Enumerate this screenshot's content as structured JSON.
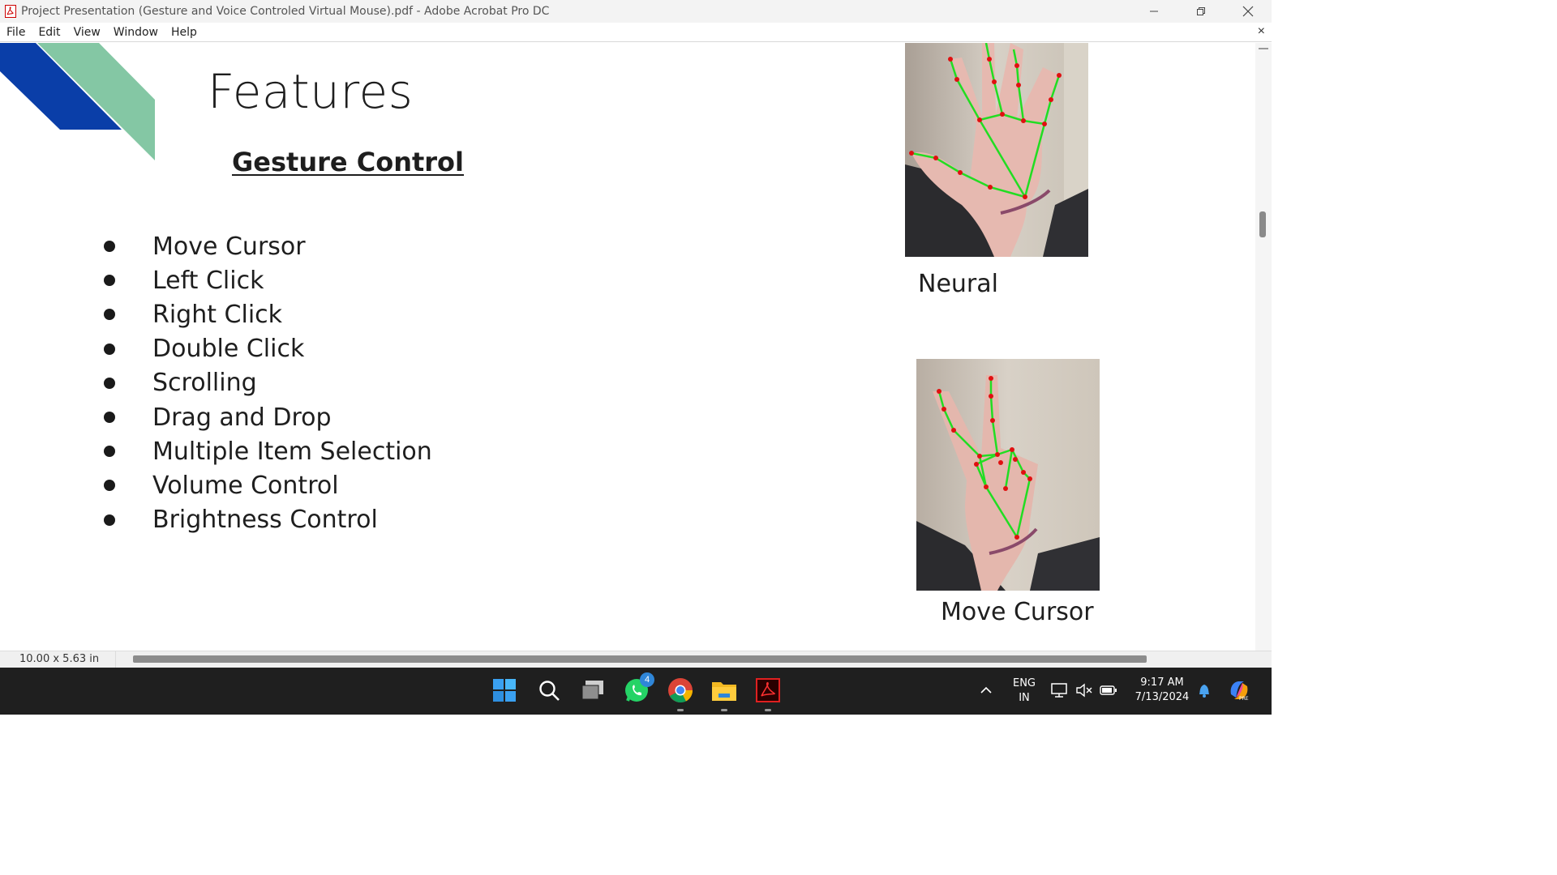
{
  "window": {
    "title": "Project Presentation (Gesture and Voice Controled Virtual Mouse).pdf - Adobe Acrobat Pro DC",
    "minimize_icon": "minimize-icon",
    "restore_icon": "restore-icon",
    "close_icon": "close-icon"
  },
  "menu": {
    "items": [
      "File",
      "Edit",
      "View",
      "Window",
      "Help"
    ],
    "close_glyph": "×"
  },
  "slide": {
    "title": "Features",
    "subtitle": "Gesture Control",
    "bullets": [
      "Move Cursor",
      "Left Click",
      "Right Click",
      "Double Click",
      "Scrolling",
      "Drag and Drop",
      "Multiple Item Selection",
      "Volume Control",
      "Brightness Control"
    ],
    "images": [
      {
        "caption": "Neural",
        "icon": "hand-open-palm-image"
      },
      {
        "caption": "Move Cursor",
        "icon": "hand-peace-sign-image"
      }
    ],
    "accent_colors": {
      "blue": "#0a3ea8",
      "green": "#84c7a4"
    }
  },
  "status": {
    "page_size": "10.00 x 5.63 in"
  },
  "taskbar": {
    "apps": [
      "start-icon",
      "search-icon",
      "task-view-icon",
      "whatsapp-icon",
      "chrome-icon",
      "file-explorer-icon",
      "acrobat-icon"
    ],
    "whatsapp_badge": "4",
    "language_line1": "ENG",
    "language_line2": "IN",
    "time": "9:17 AM",
    "date": "7/13/2024"
  }
}
